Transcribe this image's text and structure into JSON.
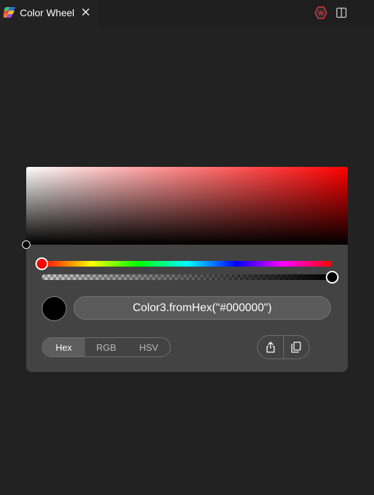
{
  "tab": {
    "title": "Color Wheel",
    "icon": "color-wheel-app-icon",
    "close_icon": "close-icon"
  },
  "actions": [
    {
      "icon": "extension-badge-icon",
      "badge": "W"
    },
    {
      "icon": "split-editor-icon"
    }
  ],
  "picker": {
    "hue_color": "#ff0000",
    "selected_color": "#000000",
    "hue_value": 0,
    "alpha_value": 1,
    "code_text": "Color3.fromHex(\"#000000\")",
    "modes": [
      {
        "label": "Hex",
        "active": true
      },
      {
        "label": "RGB",
        "active": false
      },
      {
        "label": "HSV",
        "active": false
      }
    ],
    "tools": [
      {
        "icon": "share-export-icon"
      },
      {
        "icon": "copy-icon"
      }
    ]
  },
  "colors": {
    "background": "#222222",
    "tabbar": "#1e1e1e",
    "panel": "#434343",
    "field": "#5a5a5a",
    "badge_red": "#e0383b"
  }
}
